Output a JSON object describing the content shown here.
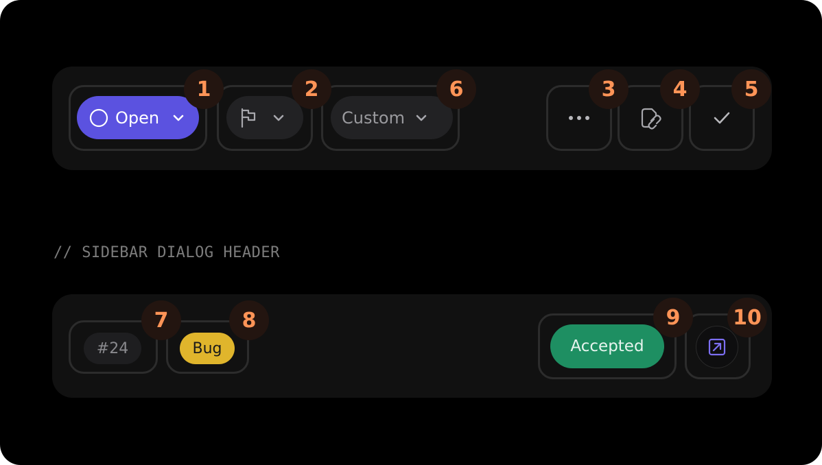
{
  "toolbar": {
    "status_label": "Open",
    "custom_label": "Custom",
    "icons": {
      "status": "circle-icon",
      "priority": "flag-icon",
      "more": "ellipsis-icon",
      "copy_link": "file-link-icon",
      "done": "check-icon",
      "chevron": "chevron-down-icon"
    }
  },
  "section_comment": "// SIDEBAR DIALOG HEADER",
  "header": {
    "issue_id": "#24",
    "issue_type": "Bug",
    "status": "Accepted",
    "open_icon": "open-external-icon"
  },
  "markers": [
    "1",
    "2",
    "3",
    "4",
    "5",
    "6",
    "7",
    "8",
    "9",
    "10"
  ],
  "colors": {
    "background": "#000000",
    "panel": "#111111",
    "frame": "#2c2c2c",
    "open_pill": "#5b52e0",
    "dark_pill": "#222224",
    "bug_tag": "#e0b52c",
    "accepted": "#1e8f62",
    "marker_bg": "#231510",
    "marker_text": "#ff9457",
    "accent_icon": "#7c6ff2"
  }
}
